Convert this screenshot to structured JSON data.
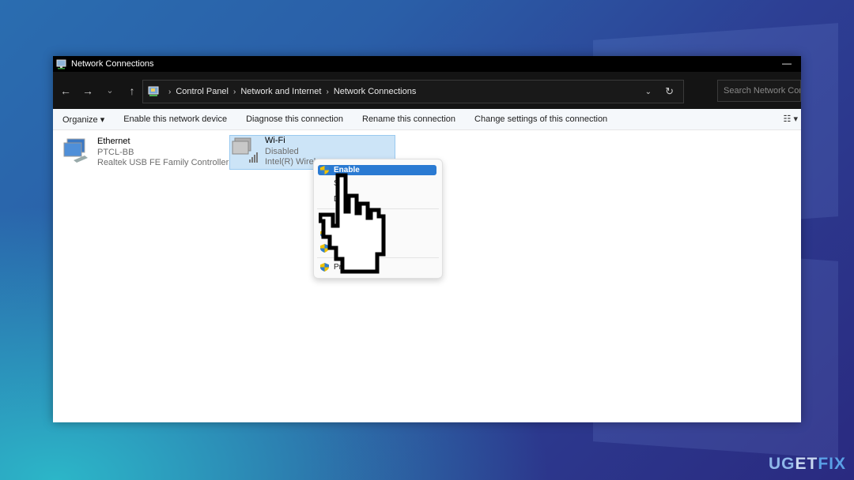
{
  "window": {
    "title": "Network Connections",
    "minimize_glyph": "—"
  },
  "nav": {
    "back_glyph": "←",
    "forward_glyph": "→",
    "recent_glyph": "⌄",
    "up_glyph": "↑",
    "breadcrumb": [
      "Control Panel",
      "Network and Internet",
      "Network Connections"
    ],
    "separator": "›",
    "dropdown_glyph": "⌄",
    "refresh_glyph": "↻",
    "search_placeholder": "Search Network Conn"
  },
  "commands": {
    "organize": "Organize ▾",
    "enable": "Enable this network device",
    "diagnose": "Diagnose this connection",
    "rename": "Rename this connection",
    "change": "Change settings of this connection",
    "view_glyph": "☷ ▾"
  },
  "connections": [
    {
      "name": "Ethernet",
      "status": "PTCL-BB",
      "device": "Realtek USB FE Family Controller"
    },
    {
      "name": "Wi-Fi",
      "status": "Disabled",
      "device": "Intel(R) Wirel"
    }
  ],
  "context_menu": {
    "items": [
      {
        "label": "Enable",
        "highlighted": true,
        "shield": true
      },
      {
        "label": "S",
        "shield": false
      },
      {
        "label": "D     e",
        "shield": false
      },
      {
        "label": "",
        "shield": true
      },
      {
        "label": "",
        "shield": true
      },
      {
        "label": "Pr",
        "shield": true
      }
    ]
  },
  "watermark": {
    "part1": "UG",
    "part2": "ET",
    "part3": "FIX"
  }
}
